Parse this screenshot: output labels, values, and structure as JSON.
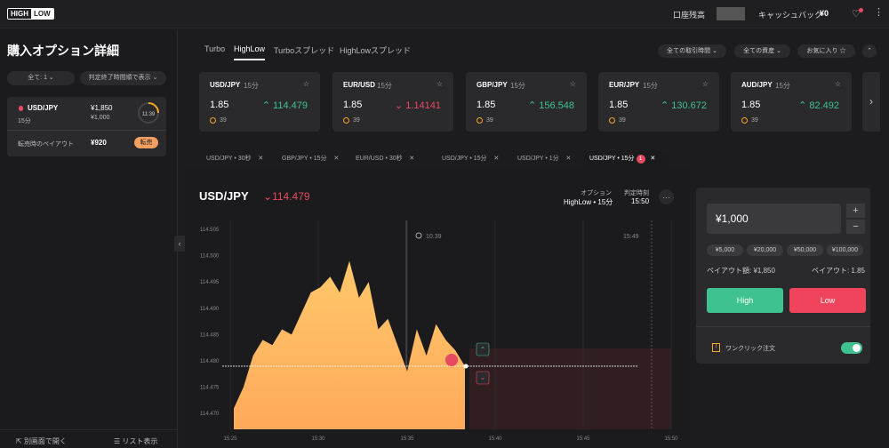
{
  "header": {
    "logo_high": "HIGH",
    "logo_low": "LOW",
    "account_label": "口座残高",
    "cashback_label": "キャッシュバック",
    "cashback_value": "¥0"
  },
  "sidebar": {
    "title": "購入オプション詳細",
    "filter_all": "全て: 1",
    "filter_sort": "判定終了時間順で表示",
    "position": {
      "pair": "USD/JPY",
      "duration": "15分",
      "amount": "¥1,850",
      "stake": "¥1,000",
      "timer": "11:39",
      "payout_label": "転売時のペイアウト",
      "payout_value": "¥920",
      "resell_label": "転売"
    },
    "open_new_window": "別画面で開く",
    "list_view": "リスト表示"
  },
  "tabs": [
    "Turbo",
    "HighLow",
    "Turboスプレッド",
    "HighLowスプレッド"
  ],
  "filters": {
    "time": "全ての取引時間",
    "assets": "全ての資産",
    "favorites": "お気に入り"
  },
  "assets": [
    {
      "name": "USD/JPY",
      "time": "15分",
      "payout": "1.85",
      "price": "114.479",
      "dir": "up",
      "count": "39"
    },
    {
      "name": "EUR/USD",
      "time": "15分",
      "payout": "1.85",
      "price": "1.14141",
      "dir": "down",
      "count": "39"
    },
    {
      "name": "GBP/JPY",
      "time": "15分",
      "payout": "1.85",
      "price": "156.548",
      "dir": "up",
      "count": "39"
    },
    {
      "name": "EUR/JPY",
      "time": "15分",
      "payout": "1.85",
      "price": "130.672",
      "dir": "up",
      "count": "39"
    },
    {
      "name": "AUD/JPY",
      "time": "15分",
      "payout": "1.85",
      "price": "82.492",
      "dir": "up",
      "count": "39"
    }
  ],
  "chart_tabs": [
    "USD/JPY • 30秒",
    "GBP/JPY • 15分",
    "EUR/USD • 30秒",
    "USD/JPY • 15分",
    "USD/JPY • 1分",
    "USD/JPY • 15分"
  ],
  "chart_tab_badge": "1",
  "chart": {
    "pair": "USD/JPY",
    "price": "114.479",
    "option_label": "オプション",
    "option_value": "HighLow • 15分",
    "expiry_label": "判定時刻",
    "expiry_value": "15:50",
    "timer": "10.39",
    "close_time": "15:49"
  },
  "chart_data": {
    "type": "area",
    "y_ticks": [
      "114.505",
      "114.500",
      "114.495",
      "114.490",
      "114.485",
      "114.480",
      "114.475",
      "114.470"
    ],
    "x_ticks": [
      "15:25",
      "15:30",
      "15:35",
      "15:40",
      "15:45",
      "15:50"
    ],
    "ylim": [
      114.467,
      114.505
    ],
    "series": [
      {
        "values": [
          114.471,
          114.475,
          114.481,
          114.484,
          114.483,
          114.486,
          114.485,
          114.489,
          114.493,
          114.494,
          114.496,
          114.493,
          114.499,
          114.492,
          114.495,
          114.486,
          114.488,
          114.483,
          114.478,
          114.486,
          114.481,
          114.487,
          114.484,
          114.482,
          114.479
        ]
      }
    ]
  },
  "trade": {
    "amount": "¥1,000",
    "quick": [
      "¥5,000",
      "¥20,000",
      "¥50,000",
      "¥100,000"
    ],
    "payout_amount": "ペイアウト額: ¥1,850",
    "payout_rate": "ペイアウト: 1.85",
    "high": "High",
    "low": "Low",
    "one_click": "ワンクリック注文"
  }
}
